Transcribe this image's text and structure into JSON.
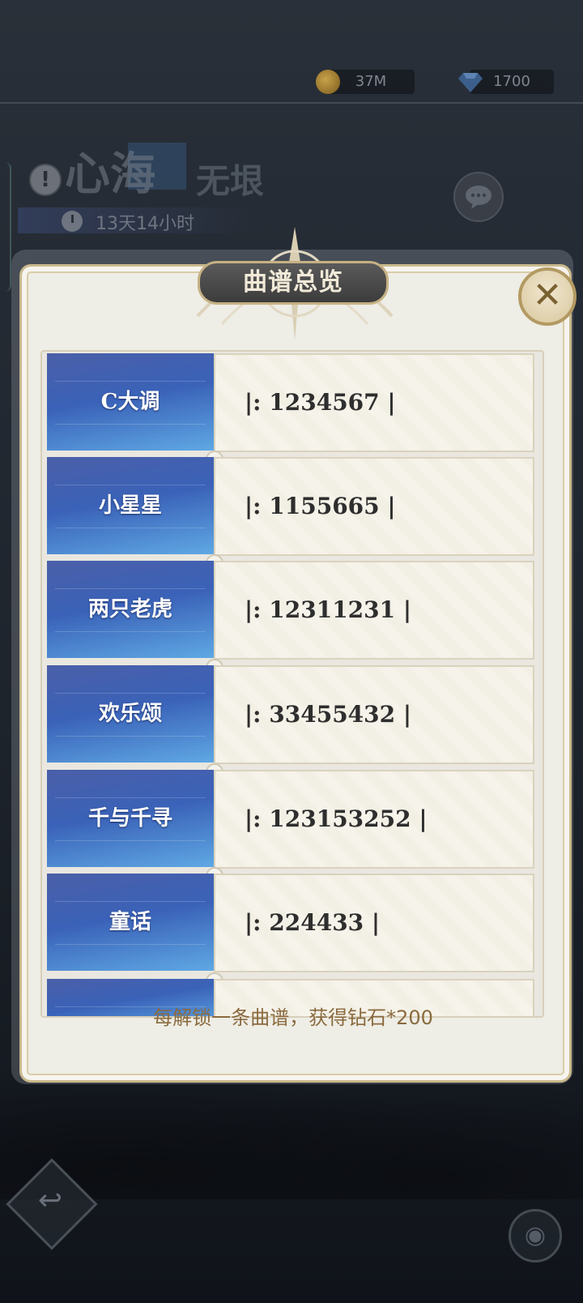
{
  "currency": {
    "coins": "37M",
    "diamonds": "1700"
  },
  "event": {
    "title_big": "心海",
    "title_small": "无垠",
    "timer": "13天14小时",
    "info_icon": "info-icon",
    "chat_icon": "chat-bubble-icon"
  },
  "modal": {
    "title": "曲谱总览",
    "close_icon": "close-icon",
    "rows": [
      {
        "name": "C大调",
        "score": "|: 1234567 |"
      },
      {
        "name": "小星星",
        "score": "|: 1155665 |"
      },
      {
        "name": "两只老虎",
        "score": "|: 12311231 |"
      },
      {
        "name": "欢乐颂",
        "score": "|: 33455432 |"
      },
      {
        "name": "千与千寻",
        "score": "|: 123153252 |"
      },
      {
        "name": "童话",
        "score": "|: 224433 |"
      }
    ],
    "footer": "每解锁一条曲谱，获得钻石*200"
  },
  "controls": {
    "back_icon": "back-arrow-icon",
    "eye_icon": "eye-toggle-icon"
  },
  "colors": {
    "name_panel": "#3a62b8",
    "footer_text": "#8a6a3e",
    "gold_border": "#c6b184"
  }
}
